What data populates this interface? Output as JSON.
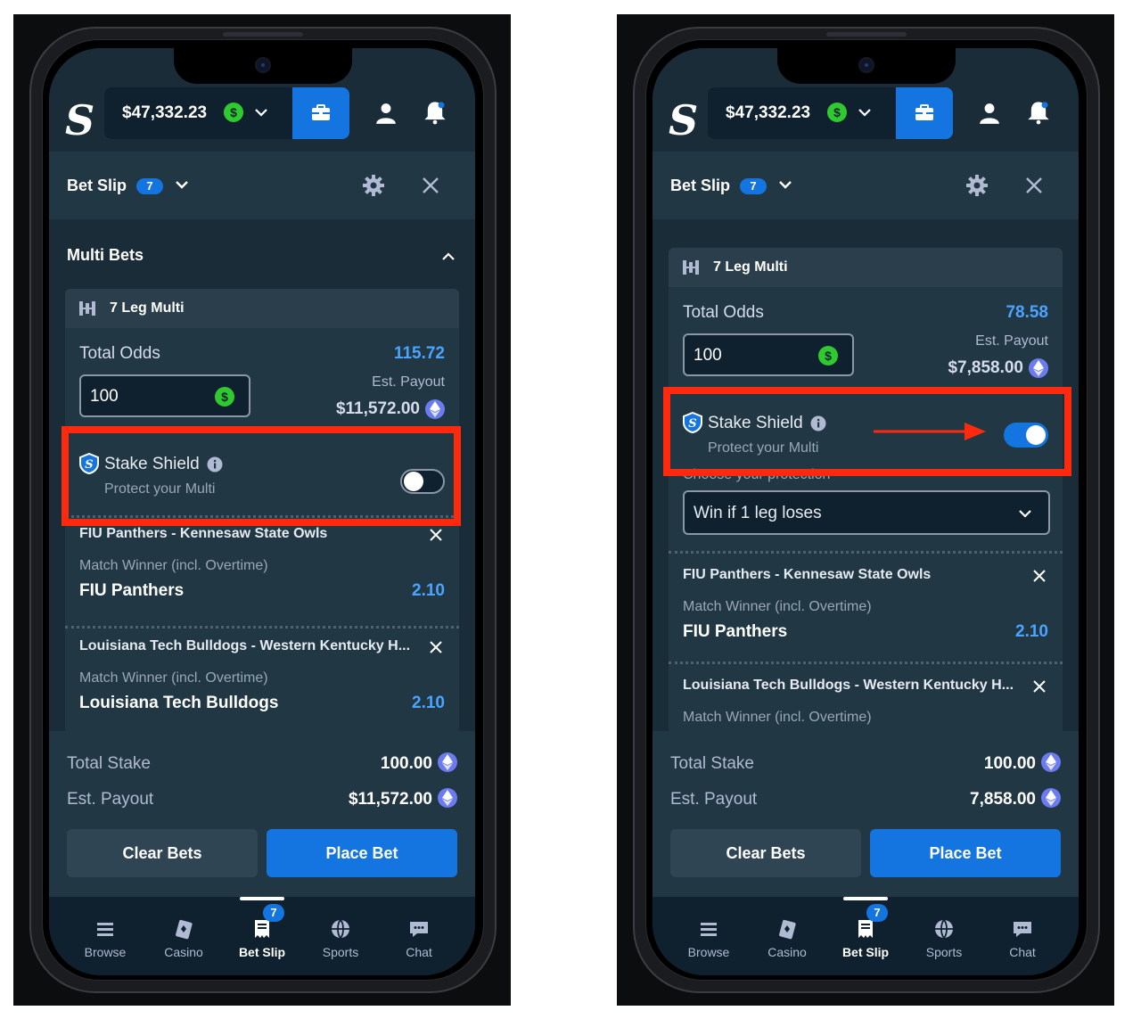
{
  "colors": {
    "accent_blue": "#1475e1",
    "odds_blue": "#4ba4ff",
    "currency_green": "#2fca2f",
    "annotation_red": "#ff2a0e",
    "bg_dark": "#1a2c38"
  },
  "screens": [
    {
      "header": {
        "logo": "S",
        "balance": "$47,332.23",
        "currency_symbol": "$",
        "wallet_icon": "wallet-icon",
        "user_icon": "user-icon",
        "bell_icon": "bell-icon"
      },
      "betslip_bar": {
        "title": "Bet Slip",
        "count": "7"
      },
      "section_title": "Multi Bets",
      "multi": {
        "label": "7 Leg Multi",
        "total_odds_label": "Total Odds",
        "total_odds": "115.72",
        "stake": "100",
        "est_payout_label": "Est. Payout",
        "est_payout": "$11,572.00"
      },
      "shield": {
        "title": "Stake Shield",
        "subtitle": "Protect your Multi",
        "enabled": false
      },
      "legs": [
        {
          "event": "FIU Panthers - Kennesaw State Owls",
          "market": "Match Winner (incl. Overtime)",
          "selection": "FIU Panthers",
          "odds": "2.10"
        },
        {
          "event": "Louisiana Tech Bulldogs - Western Kentucky H...",
          "market": "Match Winner (incl. Overtime)",
          "selection": "Louisiana Tech Bulldogs",
          "odds": "2.10"
        }
      ],
      "footer": {
        "total_stake_label": "Total Stake",
        "total_stake": "100.00",
        "est_payout_label": "Est. Payout",
        "est_payout": "$11,572.00",
        "clear_label": "Clear Bets",
        "place_label": "Place Bet"
      },
      "nav": [
        {
          "label": "Browse",
          "icon": "menu-icon"
        },
        {
          "label": "Casino",
          "icon": "casino-icon"
        },
        {
          "label": "Bet Slip",
          "icon": "betslip-icon",
          "badge": "7",
          "active": true
        },
        {
          "label": "Sports",
          "icon": "sports-icon"
        },
        {
          "label": "Chat",
          "icon": "chat-icon"
        }
      ]
    },
    {
      "header": {
        "logo": "S",
        "balance": "$47,332.23",
        "currency_symbol": "$",
        "wallet_icon": "wallet-icon",
        "user_icon": "user-icon",
        "bell_icon": "bell-icon"
      },
      "betslip_bar": {
        "title": "Bet Slip",
        "count": "7"
      },
      "multi": {
        "label": "7 Leg Multi",
        "total_odds_label": "Total Odds",
        "total_odds": "78.58",
        "stake": "100",
        "est_payout_label": "Est. Payout",
        "est_payout": "$7,858.00"
      },
      "shield": {
        "title": "Stake Shield",
        "subtitle": "Protect your Multi",
        "enabled": true,
        "choose_label": "Choose your protection",
        "protection": "Win if 1 leg loses"
      },
      "legs": [
        {
          "event": "FIU Panthers - Kennesaw State Owls",
          "market": "Match Winner (incl. Overtime)",
          "selection": "FIU Panthers",
          "odds": "2.10"
        },
        {
          "event": "Louisiana Tech Bulldogs - Western Kentucky H...",
          "market": "Match Winner (incl. Overtime)"
        }
      ],
      "footer": {
        "total_stake_label": "Total Stake",
        "total_stake": "100.00",
        "est_payout_label": "Est. Payout",
        "est_payout": "7,858.00",
        "clear_label": "Clear Bets",
        "place_label": "Place Bet"
      },
      "nav": [
        {
          "label": "Browse",
          "icon": "menu-icon"
        },
        {
          "label": "Casino",
          "icon": "casino-icon"
        },
        {
          "label": "Bet Slip",
          "icon": "betslip-icon",
          "badge": "7",
          "active": true
        },
        {
          "label": "Sports",
          "icon": "sports-icon"
        },
        {
          "label": "Chat",
          "icon": "chat-icon"
        }
      ]
    }
  ]
}
